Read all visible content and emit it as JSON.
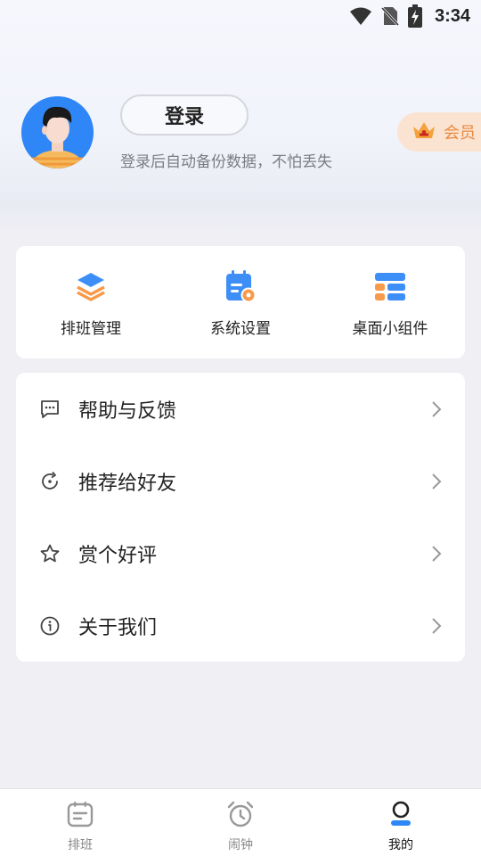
{
  "status_bar": {
    "time": "3:34"
  },
  "profile": {
    "login_label": "登录",
    "tip": "登录后自动备份数据，不怕丢失",
    "vip_label": "会员"
  },
  "shortcuts": [
    {
      "label": "排班管理",
      "icon": "layers-icon"
    },
    {
      "label": "系统设置",
      "icon": "calendar-settings-icon"
    },
    {
      "label": "桌面小组件",
      "icon": "widget-icon"
    }
  ],
  "menu": [
    {
      "label": "帮助与反馈",
      "icon": "feedback-icon"
    },
    {
      "label": "推荐给好友",
      "icon": "share-refresh-icon"
    },
    {
      "label": "赏个好评",
      "icon": "star-icon"
    },
    {
      "label": "关于我们",
      "icon": "info-icon"
    }
  ],
  "tabbar": [
    {
      "label": "排班",
      "icon": "schedule-icon"
    },
    {
      "label": "闹钟",
      "icon": "alarm-icon"
    },
    {
      "label": "我的",
      "icon": "profile-icon",
      "active": true
    }
  ],
  "colors": {
    "accent": "#2f86f6",
    "orange": "#f79a4b",
    "vip": "#e88a3f"
  }
}
